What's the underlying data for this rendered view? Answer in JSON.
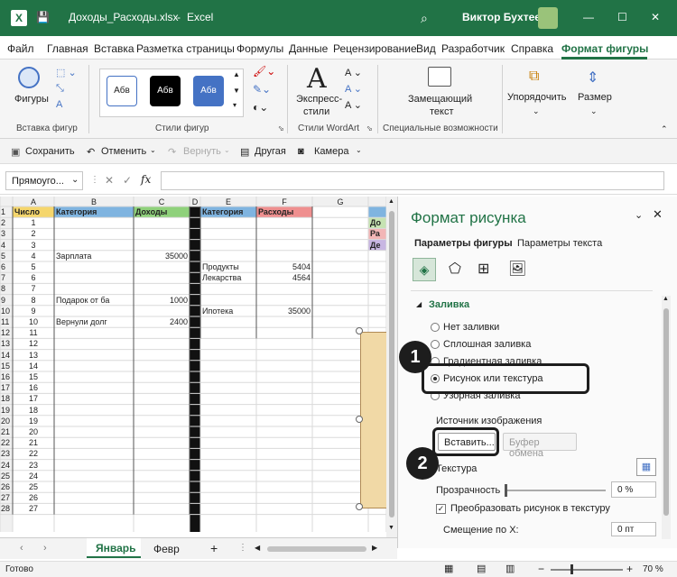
{
  "title": {
    "filename": "Доходы_Расходы.xlsx",
    "separator": "-",
    "app": "Excel",
    "user": "Виктор Бухтеев",
    "accent": "#217346"
  },
  "tabs": [
    "Файл",
    "Главная",
    "Вставка",
    "Разметка страницы",
    "Формулы",
    "Данные",
    "Рецензирование",
    "Вид",
    "Разработчик",
    "Справка",
    "Формат фигуры"
  ],
  "ribbon": {
    "shapes_label": "Фигуры",
    "insert_shapes_group": "Вставка фигур",
    "style1": "Абв",
    "style2": "Абв",
    "style3": "Абв",
    "shape_styles_group": "Стили фигур",
    "express_styles_line1": "Экспресс-",
    "express_styles_line2": "стили",
    "wordart_group": "Стили WordArt",
    "alt_text_line1": "Замещающий",
    "alt_text_line2": "текст",
    "accessibility_group": "Специальные возможности",
    "arrange": "Упорядочить",
    "size": "Размер"
  },
  "qat": {
    "save": "Сохранить",
    "undo": "Отменить",
    "redo": "Вернуть",
    "other": "Другая",
    "camera": "Камера"
  },
  "formula_bar": {
    "name_box": "Прямоуго...",
    "fx": "fx"
  },
  "sheet": {
    "columns": [
      "A",
      "B",
      "C",
      "D",
      "E",
      "F",
      "G"
    ],
    "headers": {
      "a": "Число",
      "b": "Категория",
      "c": "Доходы",
      "e": "Категория",
      "f": "Расходы"
    },
    "numbers": [
      "1",
      "2",
      "3",
      "4",
      "5",
      "6",
      "7",
      "8",
      "9",
      "10",
      "11",
      "12",
      "13",
      "14",
      "15",
      "16",
      "17",
      "18",
      "19",
      "20",
      "21",
      "22",
      "23",
      "24",
      "25",
      "26",
      "27"
    ],
    "row_labels": [
      "1",
      "2",
      "3",
      "4",
      "5",
      "6",
      "7",
      "8",
      "9",
      "10",
      "11",
      "12",
      "13",
      "14",
      "15",
      "16",
      "17",
      "18",
      "19",
      "20",
      "21",
      "22",
      "23",
      "24",
      "25",
      "26",
      "27",
      "28"
    ],
    "income": [
      {
        "row": 5,
        "cat": "Зарплата",
        "val": "35000"
      },
      {
        "row": 9,
        "cat": "Подарок от ба",
        "val": "1000"
      },
      {
        "row": 11,
        "cat": "Вернули долг",
        "val": "2400"
      }
    ],
    "expenses": [
      {
        "row": 6,
        "cat": "Продукты",
        "val": "5404"
      },
      {
        "row": 7,
        "cat": "Лекарства",
        "val": "4564"
      },
      {
        "row": 10,
        "cat": "Ипотека",
        "val": "35000"
      }
    ],
    "partial_cells": [
      "До",
      "Ра",
      "Де"
    ]
  },
  "sheet_tabs": {
    "active": "Январь",
    "next": "Февр",
    "add": "+"
  },
  "status": {
    "ready": "Готово",
    "zoom": "70 %"
  },
  "pane": {
    "title": "Формат рисунка",
    "tab_shape": "Параметры фигуры",
    "tab_text": "Параметры текста",
    "fill_section": "Заливка",
    "fill_options": [
      "Нет заливки",
      "Сплошная заливка",
      "Градиентная заливка",
      "Рисунок или текстура",
      "Узорная заливка"
    ],
    "selected_option": "Рисунок или текстура",
    "image_source": "Источник изображения",
    "insert_button": "Вставить...",
    "clipboard_button": "Буфер обмена",
    "texture": "Текстура",
    "transparency": "Прозрачность",
    "transparency_value": "0 %",
    "tile_checkbox": "Преобразовать рисунок в текстуру",
    "offset_x": "Смещение по X:",
    "offset_value": "0 пт"
  },
  "markers": [
    "1",
    "2"
  ]
}
